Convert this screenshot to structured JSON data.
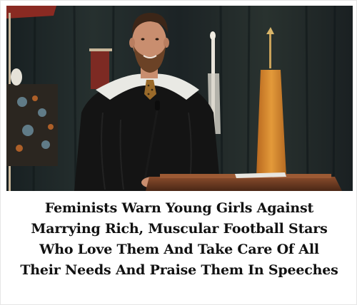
{
  "headline": {
    "lines": [
      "Feminists Warn Young Girls Against",
      "Marrying Rich, Muscular Football Stars",
      "Who Love Them And Take Care Of All",
      "Their Needs And Praise Them In Speeches"
    ]
  },
  "photo": {
    "subject": "speaker-in-graduation-gown-at-podium",
    "colors": {
      "curtain": "#1f2628",
      "gown": "#141414",
      "hood": "#e9e9e4",
      "podium": "#6a3a22",
      "flag_gold": "#d98a2b",
      "banner_red": "#8a2a22",
      "skin": "#c98e6f",
      "beard": "#6b4226"
    }
  }
}
